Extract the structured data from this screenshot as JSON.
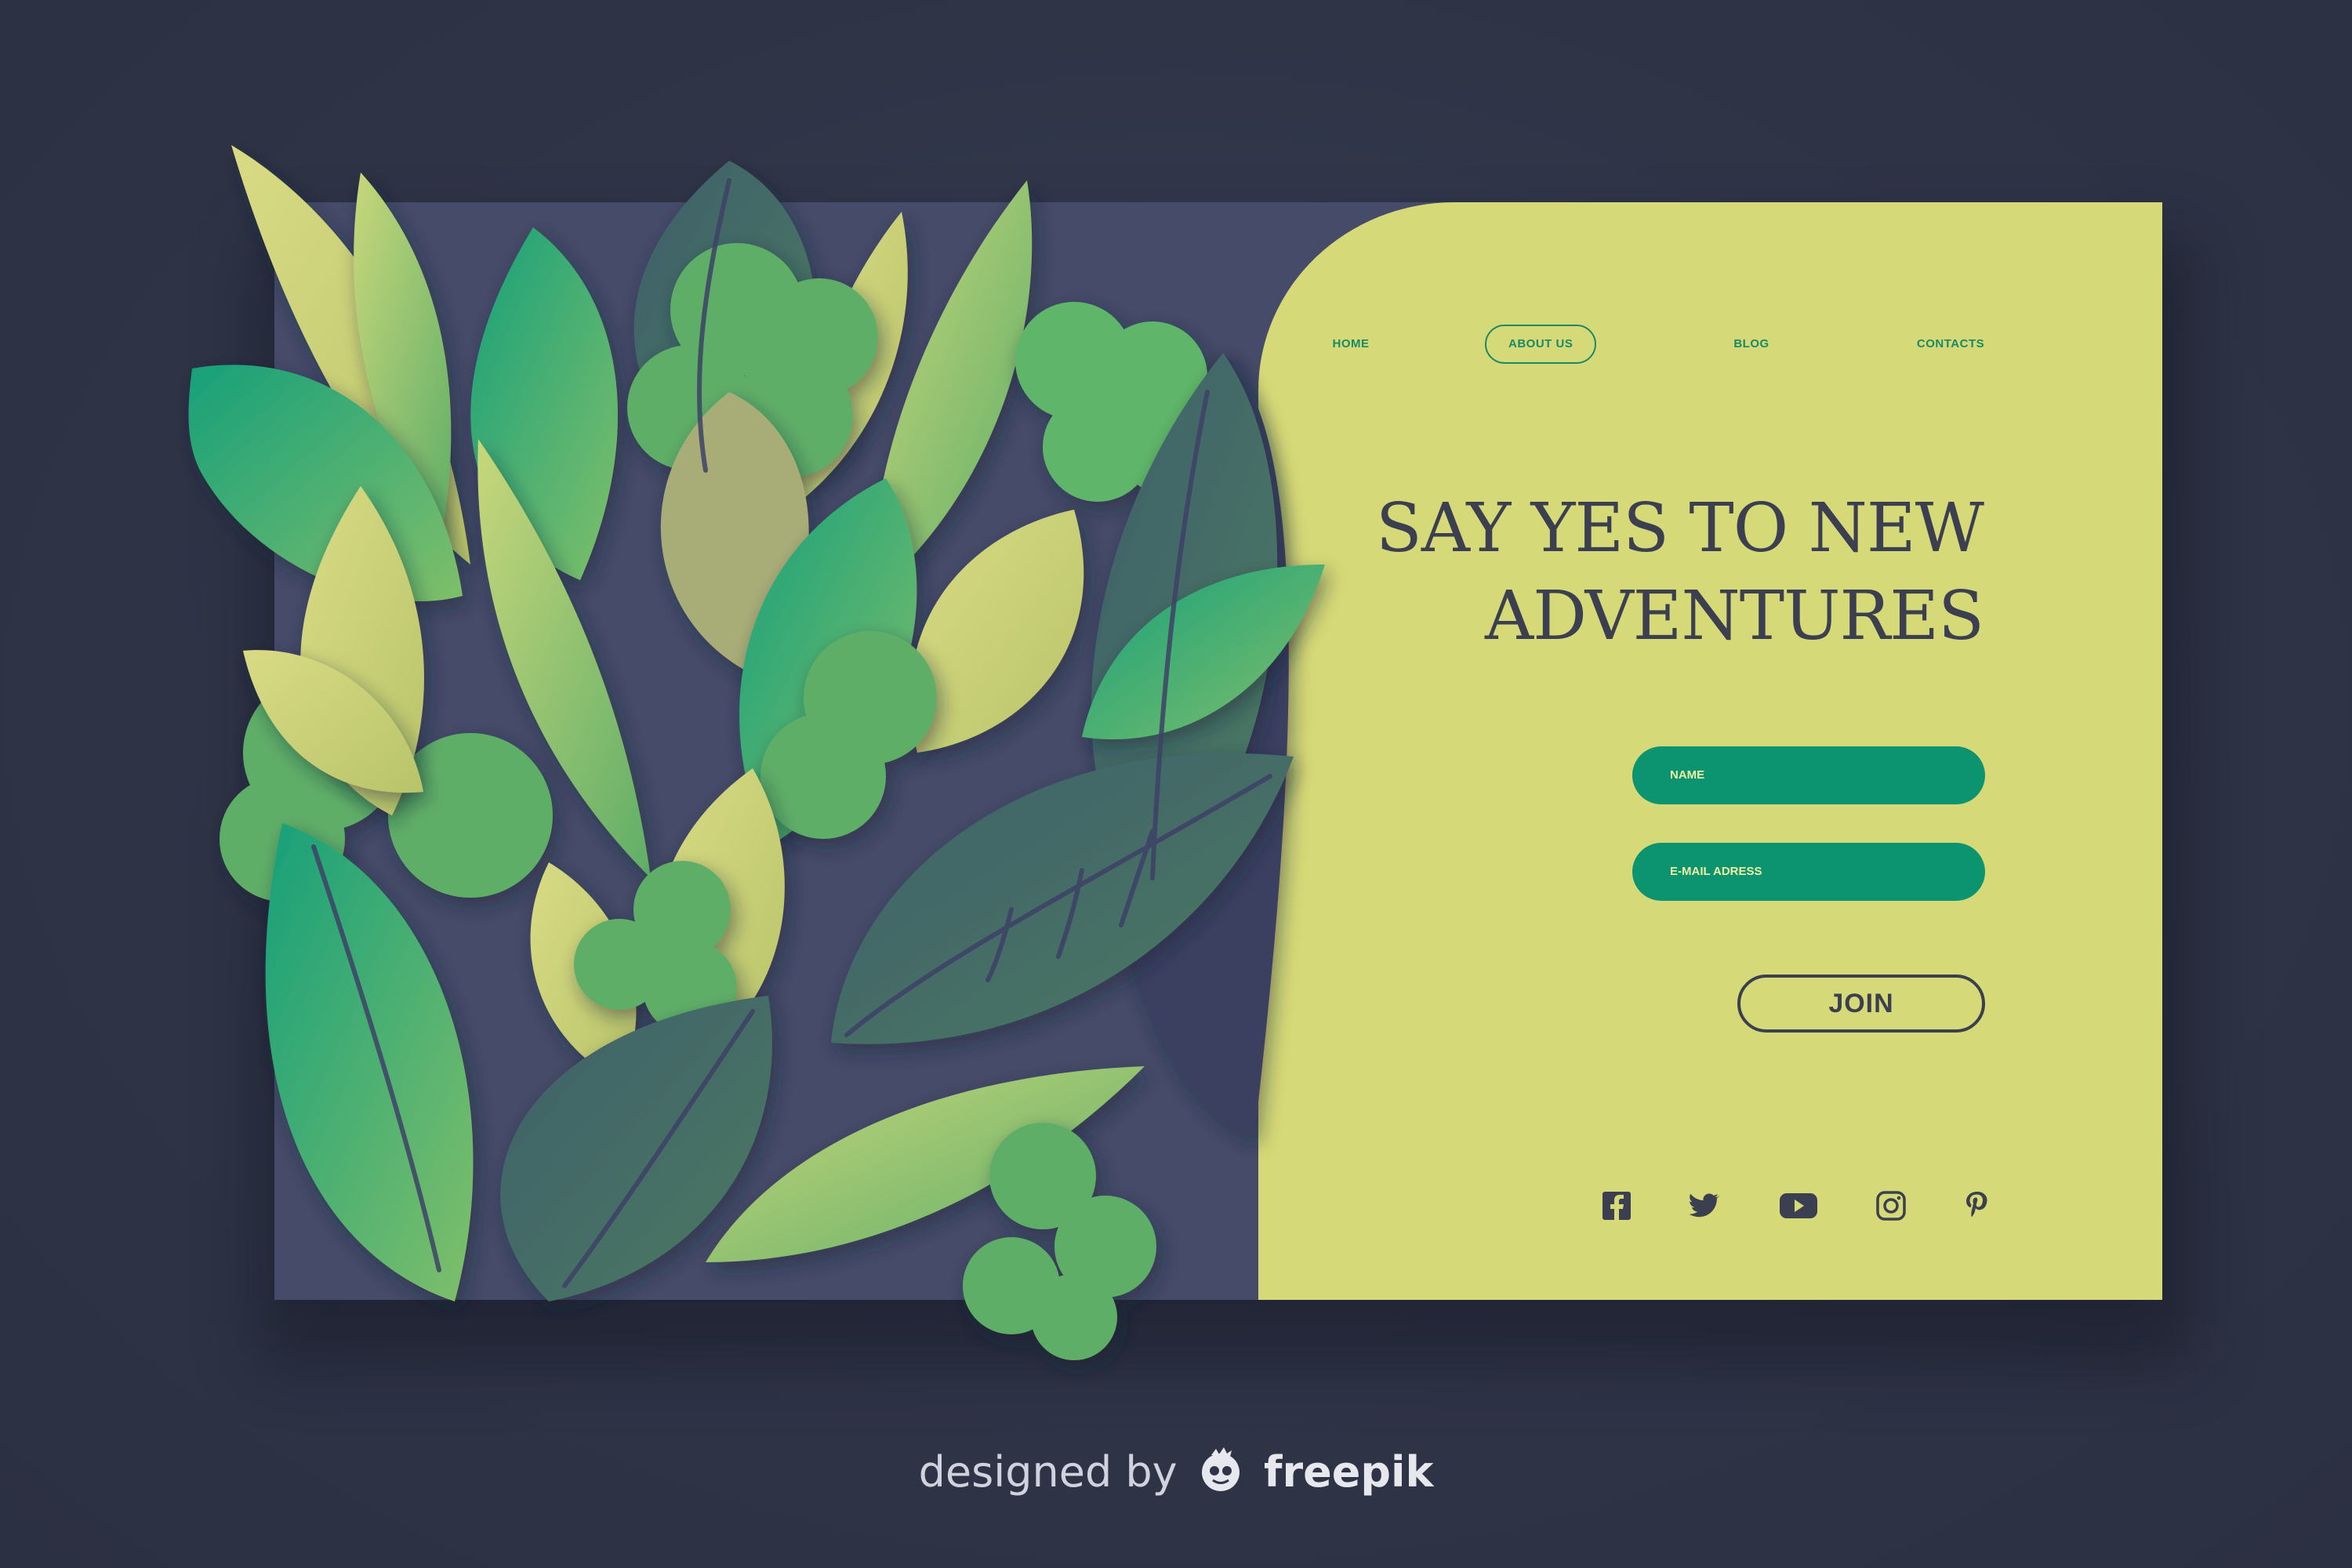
{
  "nav": {
    "items": [
      {
        "label": "HOME"
      },
      {
        "label": "ABOUT US",
        "active": true
      },
      {
        "label": "BLOG"
      },
      {
        "label": "CONTACTS"
      }
    ]
  },
  "hero": {
    "headline_line1": "SAY YES TO NEW",
    "headline_line2": "ADVENTURES"
  },
  "form": {
    "name_placeholder": "NAME",
    "email_placeholder": "E-MAIL ADRESS",
    "join_label": "JOIN"
  },
  "social": {
    "icons": [
      "facebook-icon",
      "twitter-icon",
      "youtube-icon",
      "instagram-icon",
      "pinterest-icon"
    ]
  },
  "credit": {
    "prefix": "designed by",
    "brand": "freepik"
  },
  "colors": {
    "background": "#2f3447",
    "card_dark": "#454b68",
    "card_yellow": "#d6d977",
    "accent_green": "#0c9470",
    "text_dark": "#3b3f4f"
  }
}
